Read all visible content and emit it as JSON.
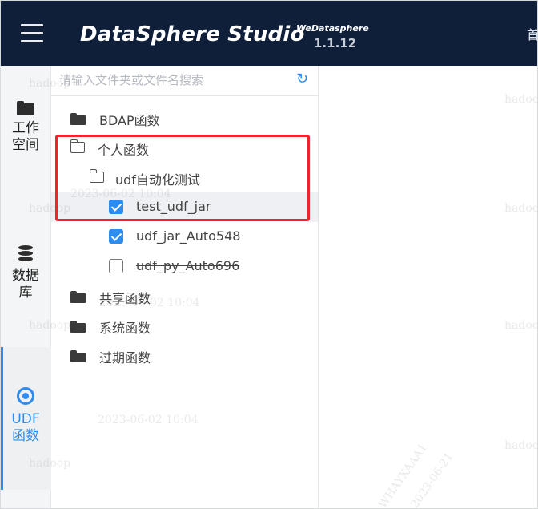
{
  "header": {
    "brand": "DataSphere Studio",
    "brand_sub": "WeDatasphere",
    "version": "1.1.12",
    "nav_partial": "首"
  },
  "rail": {
    "items": [
      {
        "label_line1": "工作",
        "label_line2": "空间",
        "icon": "folder-icon",
        "active": false
      },
      {
        "label_line1": "数据",
        "label_line2": "库",
        "icon": "database-icon",
        "active": false
      },
      {
        "label_line1": "UDF",
        "label_line2": "函数",
        "icon": "target-icon",
        "active": true
      }
    ]
  },
  "search": {
    "placeholder": "请输入文件夹或文件名搜索",
    "refresh_icon": "refresh-icon"
  },
  "tree": [
    {
      "label": "BDAP函数",
      "type": "folder",
      "state": "closed"
    },
    {
      "label": "个人函数",
      "type": "folder",
      "state": "open"
    },
    {
      "label": "udf自动化测试",
      "type": "folder",
      "state": "open"
    },
    {
      "label": "test_udf_jar",
      "type": "file",
      "checked": true,
      "selected": true
    },
    {
      "label": "udf_jar_Auto548",
      "type": "file",
      "checked": true
    },
    {
      "label": "udf_py_Auto696",
      "type": "file",
      "checked": false,
      "struck": true
    },
    {
      "label": "共享函数",
      "type": "folder",
      "state": "closed"
    },
    {
      "label": "系统函数",
      "type": "folder",
      "state": "closed"
    },
    {
      "label": "过期函数",
      "type": "folder",
      "state": "closed"
    }
  ],
  "colors": {
    "header_bg": "#0f1f3a",
    "accent": "#2d8cf0",
    "highlight_border": "#f0242a"
  },
  "watermarks": {
    "user": "hadoop",
    "datetime": "2023-06-02 10:04",
    "date": "2023-06-21",
    "code": "WHAYXAAA1"
  }
}
